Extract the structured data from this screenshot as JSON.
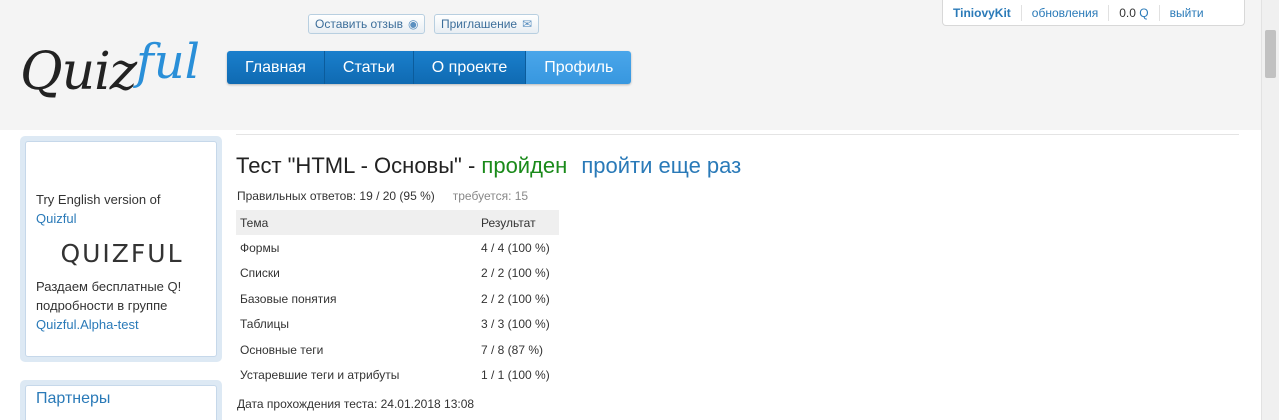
{
  "logo": {
    "part1": "Quiz",
    "part2": "ful"
  },
  "top_buttons": {
    "feedback": "Оставить отзыв",
    "invite": "Приглашение"
  },
  "nav": {
    "items": [
      "Главная",
      "Статьи",
      "О проекте",
      "Профиль"
    ],
    "active": "Профиль"
  },
  "userbar": {
    "username": "TiniovyKit",
    "updates": "обновления",
    "score_value": "0.0",
    "score_unit": "Q",
    "logout": "выйти"
  },
  "promo": {
    "line1": "Try English version of",
    "link1": "Quizful",
    "logo_text": "QUIZFUL",
    "line2": "Раздаем бесплатные Q!",
    "line3": "подробности в группе",
    "link2": "Quizful.Alpha-test"
  },
  "partners": {
    "title": "Партнеры"
  },
  "test": {
    "title": "Тест \"HTML - Основы\" - ",
    "status": "пройден",
    "retry": "пройти еще раз",
    "correct_label": "Правильных ответов: 19 / 20 (95 %)",
    "required_label": "требуется: 15",
    "table": {
      "headers": [
        "Тема",
        "Результат"
      ],
      "rows": [
        [
          "Формы",
          "4 / 4 (100 %)"
        ],
        [
          "Списки",
          "2 / 2 (100 %)"
        ],
        [
          "Базовые понятия",
          "2 / 2 (100 %)"
        ],
        [
          "Таблицы",
          "3 / 3 (100 %)"
        ],
        [
          "Основные теги",
          "7 / 8 (87 %)"
        ],
        [
          "Устаревшие теги и атрибуты",
          "1 / 1 (100 %)"
        ]
      ]
    },
    "date_label": "Дата прохождения теста: 24.01.2018 13:08"
  },
  "colors": {
    "accent": "#2a7ab8",
    "nav": "#1a7fcc",
    "passed": "#1a8a1a"
  }
}
